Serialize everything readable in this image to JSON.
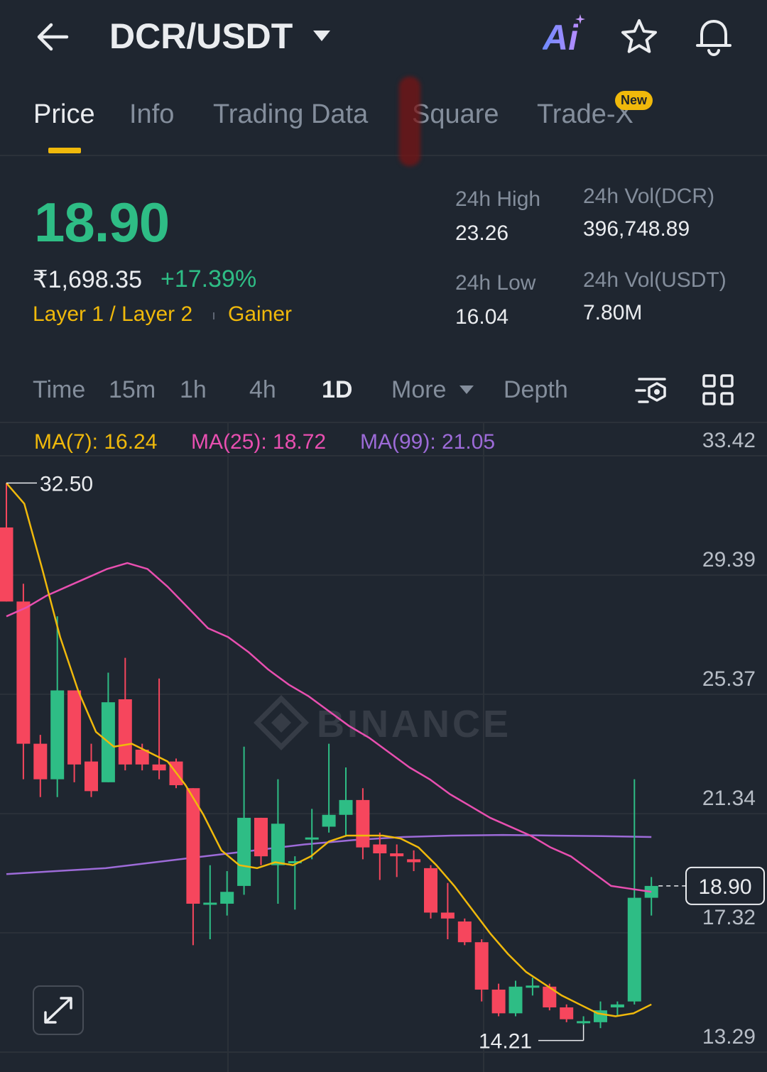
{
  "header": {
    "pair": "DCR/USDT",
    "ai_label": "Ai",
    "icons": [
      "back-arrow-icon",
      "chevron-down-icon",
      "ai-icon",
      "star-icon",
      "bell-icon"
    ]
  },
  "tabs": [
    {
      "label": "Price",
      "active": true
    },
    {
      "label": "Info",
      "active": false
    },
    {
      "label": "Trading Data",
      "active": false
    },
    {
      "label": "Square",
      "active": false
    },
    {
      "label": "Trade-X",
      "active": false,
      "badge": "New"
    }
  ],
  "ticker": {
    "last_price": "18.90",
    "fiat_price": "₹1,698.35",
    "change_pct": "+17.39%",
    "tags": [
      "Layer 1 / Layer 2",
      "Gainer"
    ],
    "high_label": "24h High",
    "high_value": "23.26",
    "low_label": "24h Low",
    "low_value": "16.04",
    "vol_base_label": "24h Vol(DCR)",
    "vol_base_value": "396,748.89",
    "vol_quote_label": "24h Vol(USDT)",
    "vol_quote_value": "7.80M"
  },
  "intervals": {
    "items": [
      "Time",
      "15m",
      "1h",
      "4h",
      "1D",
      "More",
      "Depth"
    ],
    "active": "1D"
  },
  "colors": {
    "up": "#2ebd85",
    "down": "#f6465d",
    "accent": "#f0b90b",
    "ma7": "#f0b90b",
    "ma25": "#e84fb0",
    "ma99": "#9d6bd8"
  },
  "indicators": {
    "ma7": "MA(7): 16.24",
    "ma25": "MA(25): 18.72",
    "ma99": "MA(99): 21.05"
  },
  "watermark": "BINANCE",
  "chart_data": {
    "type": "candlestick",
    "y_ticks": [
      "33.42",
      "29.39",
      "25.37",
      "21.34",
      "17.32",
      "13.29"
    ],
    "ylim": [
      13.29,
      33.42
    ],
    "max_marker": "32.50",
    "min_marker": "14.21",
    "last_price_label": "18.90",
    "candles": [
      {
        "o": 31.0,
        "c": 28.5,
        "h": 32.5,
        "l": 28.5
      },
      {
        "o": 28.5,
        "c": 23.7,
        "h": 29.1,
        "l": 22.5
      },
      {
        "o": 23.7,
        "c": 22.5,
        "h": 24.0,
        "l": 21.9
      },
      {
        "o": 22.5,
        "c": 25.5,
        "h": 28.0,
        "l": 21.9
      },
      {
        "o": 25.5,
        "c": 23.0,
        "h": 25.5,
        "l": 22.4
      },
      {
        "o": 23.1,
        "c": 22.1,
        "h": 23.7,
        "l": 21.9
      },
      {
        "o": 22.4,
        "c": 25.1,
        "h": 26.1,
        "l": 22.4
      },
      {
        "o": 25.2,
        "c": 23.0,
        "h": 26.6,
        "l": 22.8
      },
      {
        "o": 23.5,
        "c": 23.0,
        "h": 23.7,
        "l": 22.8
      },
      {
        "o": 23.0,
        "c": 22.8,
        "h": 25.9,
        "l": 22.5
      },
      {
        "o": 23.1,
        "c": 22.3,
        "h": 23.2,
        "l": 22.2
      },
      {
        "o": 22.2,
        "c": 18.3,
        "h": 22.2,
        "l": 16.9
      },
      {
        "o": 18.3,
        "c": 18.3,
        "h": 19.6,
        "l": 17.1
      },
      {
        "o": 18.3,
        "c": 18.7,
        "h": 19.4,
        "l": 17.9
      },
      {
        "o": 18.9,
        "c": 21.2,
        "h": 23.6,
        "l": 18.6
      },
      {
        "o": 21.2,
        "c": 19.9,
        "h": 21.2,
        "l": 19.6
      },
      {
        "o": 19.6,
        "c": 21.0,
        "h": 22.5,
        "l": 18.3
      },
      {
        "o": 19.7,
        "c": 19.7,
        "h": 19.9,
        "l": 18.1
      },
      {
        "o": 20.5,
        "c": 20.5,
        "h": 21.5,
        "l": 19.8
      },
      {
        "o": 20.9,
        "c": 21.3,
        "h": 23.7,
        "l": 20.7
      },
      {
        "o": 21.3,
        "c": 21.8,
        "h": 22.9,
        "l": 20.6
      },
      {
        "o": 21.8,
        "c": 20.2,
        "h": 22.2,
        "l": 19.8
      },
      {
        "o": 20.3,
        "c": 20.0,
        "h": 20.7,
        "l": 19.1
      },
      {
        "o": 20.0,
        "c": 19.9,
        "h": 20.3,
        "l": 19.2
      },
      {
        "o": 19.8,
        "c": 19.7,
        "h": 20.1,
        "l": 19.4
      },
      {
        "o": 19.5,
        "c": 18.0,
        "h": 19.6,
        "l": 17.8
      },
      {
        "o": 18.0,
        "c": 17.8,
        "h": 19.0,
        "l": 17.1
      },
      {
        "o": 17.7,
        "c": 17.0,
        "h": 17.8,
        "l": 16.9
      },
      {
        "o": 17.0,
        "c": 15.4,
        "h": 17.1,
        "l": 15.0
      },
      {
        "o": 15.4,
        "c": 14.6,
        "h": 15.6,
        "l": 14.5
      },
      {
        "o": 14.6,
        "c": 15.5,
        "h": 15.7,
        "l": 14.5
      },
      {
        "o": 15.5,
        "c": 15.5,
        "h": 15.8,
        "l": 15.2
      },
      {
        "o": 15.5,
        "c": 14.8,
        "h": 15.6,
        "l": 14.7
      },
      {
        "o": 14.8,
        "c": 14.4,
        "h": 14.9,
        "l": 14.3
      },
      {
        "o": 14.3,
        "c": 14.3,
        "h": 14.5,
        "l": 14.21
      },
      {
        "o": 14.3,
        "c": 14.7,
        "h": 15.0,
        "l": 14.1
      },
      {
        "o": 14.8,
        "c": 14.9,
        "h": 15.0,
        "l": 14.5
      },
      {
        "o": 15.0,
        "c": 18.5,
        "h": 22.5,
        "l": 14.9
      },
      {
        "o": 18.5,
        "c": 18.9,
        "h": 19.2,
        "l": 17.9
      }
    ],
    "ma7_line": [
      32.5,
      31.8,
      29.6,
      27.3,
      25.5,
      24.1,
      23.6,
      23.7,
      23.4,
      23.1,
      22.3,
      21.3,
      20.1,
      19.6,
      19.5,
      19.7,
      19.6,
      19.9,
      20.4,
      20.6,
      20.6,
      20.6,
      20.5,
      20.2,
      19.6,
      18.9,
      18.1,
      17.3,
      16.6,
      16.0,
      15.6,
      15.2,
      14.9,
      14.6,
      14.5,
      14.6,
      14.9
    ],
    "ma25_line": [
      28.0,
      28.3,
      28.7,
      29.0,
      29.3,
      29.6,
      29.8,
      29.6,
      29.0,
      28.3,
      27.6,
      27.3,
      26.8,
      26.2,
      25.7,
      25.3,
      24.8,
      24.3,
      23.9,
      23.4,
      22.9,
      22.5,
      22.0,
      21.6,
      21.2,
      20.9,
      20.6,
      20.2,
      19.9,
      19.4,
      18.9,
      18.8,
      18.7
    ],
    "ma99_line": [
      19.3,
      19.4,
      19.5,
      19.7,
      19.9,
      20.1,
      20.3,
      20.45,
      20.55,
      20.6,
      20.62,
      20.6,
      20.58,
      20.55
    ]
  }
}
